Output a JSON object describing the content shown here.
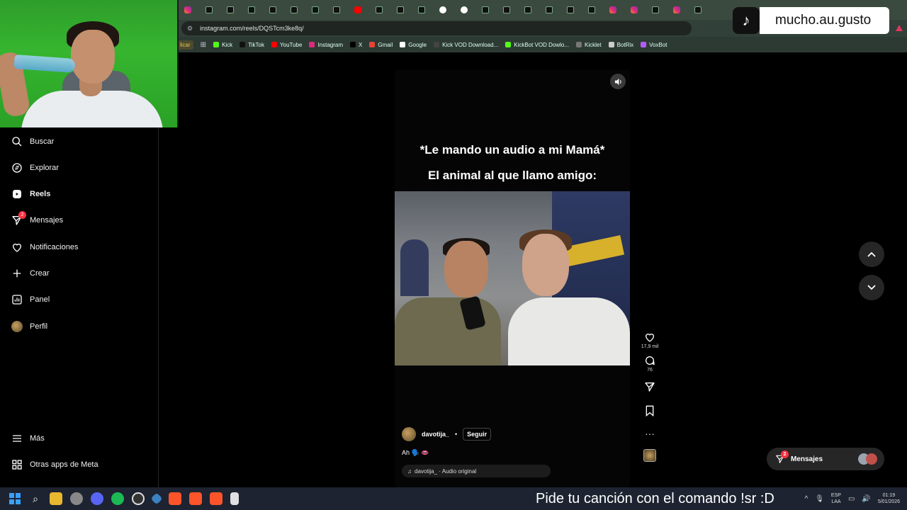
{
  "browser": {
    "url": "instagram.com/reels/DQSTcm3ke8q/",
    "tab_favicons": [
      "insta",
      "tiktok",
      "tiktok",
      "tiktok",
      "tiktok",
      "tiktok",
      "tiktok",
      "tiktok",
      "yt",
      "tiktok",
      "tiktok",
      "tiktok",
      "g",
      "g",
      "tiktok",
      "tiktok",
      "tiktok",
      "tiktok",
      "tiktok",
      "tiktok",
      "insta",
      "insta",
      "tiktok",
      "insta",
      "tiktok"
    ],
    "bookmarks": [
      {
        "label": "Kick",
        "color": "#53fc18"
      },
      {
        "label": "TikTok",
        "color": "#111111"
      },
      {
        "label": "YouTube",
        "color": "#ff0000"
      },
      {
        "label": "Instagram",
        "color": "#dd2a7b"
      },
      {
        "label": "X",
        "color": "#000000"
      },
      {
        "label": "Gmail",
        "color": "#ea4335"
      },
      {
        "label": "Google",
        "color": "#ffffff"
      },
      {
        "label": "Kick VOD Download...",
        "color": "#444444"
      },
      {
        "label": "KickBot VOD Dowlo...",
        "color": "#53fc18"
      },
      {
        "label": "Kicklet",
        "color": "#777777"
      },
      {
        "label": "BotRix",
        "color": "#cccccc"
      },
      {
        "label": "VoxBot",
        "color": "#b45cff"
      }
    ],
    "bookmarks_cut_label": "licar"
  },
  "sidebar": {
    "items": [
      {
        "label": "Buscar",
        "icon": "search-icon"
      },
      {
        "label": "Explorar",
        "icon": "compass-icon"
      },
      {
        "label": "Reels",
        "icon": "reels-icon",
        "active": true
      },
      {
        "label": "Mensajes",
        "icon": "messenger-icon",
        "badge": "2"
      },
      {
        "label": "Notificaciones",
        "icon": "heart-icon"
      },
      {
        "label": "Crear",
        "icon": "plus-icon"
      },
      {
        "label": "Panel",
        "icon": "chart-icon"
      },
      {
        "label": "Perfil",
        "icon": "avatar"
      }
    ],
    "more_label": "Más",
    "meta_label": "Otras apps de Meta"
  },
  "reel": {
    "caption_line1": "*Le mando un audio a mi Mamá*",
    "caption_line2": "El animal al que llamo amigo:",
    "author": "davotija_",
    "separator": "•",
    "follow_label": "Seguir",
    "text": "Ah 🗣️ 👄",
    "audio_label": "davotija_ · Audio original"
  },
  "actions": {
    "likes": "17,9 mil",
    "comments": "76"
  },
  "messages_pill": {
    "label": "Mensajes",
    "badge": "2"
  },
  "overlay": {
    "tiktok_name": "mucho.au.gusto"
  },
  "taskbar": {
    "ticker": "Pide tu canción con el comando !sr :D",
    "lang_top": "ESP",
    "lang_bottom": "LAA",
    "time": "01:19",
    "date": "5/01/2026"
  }
}
